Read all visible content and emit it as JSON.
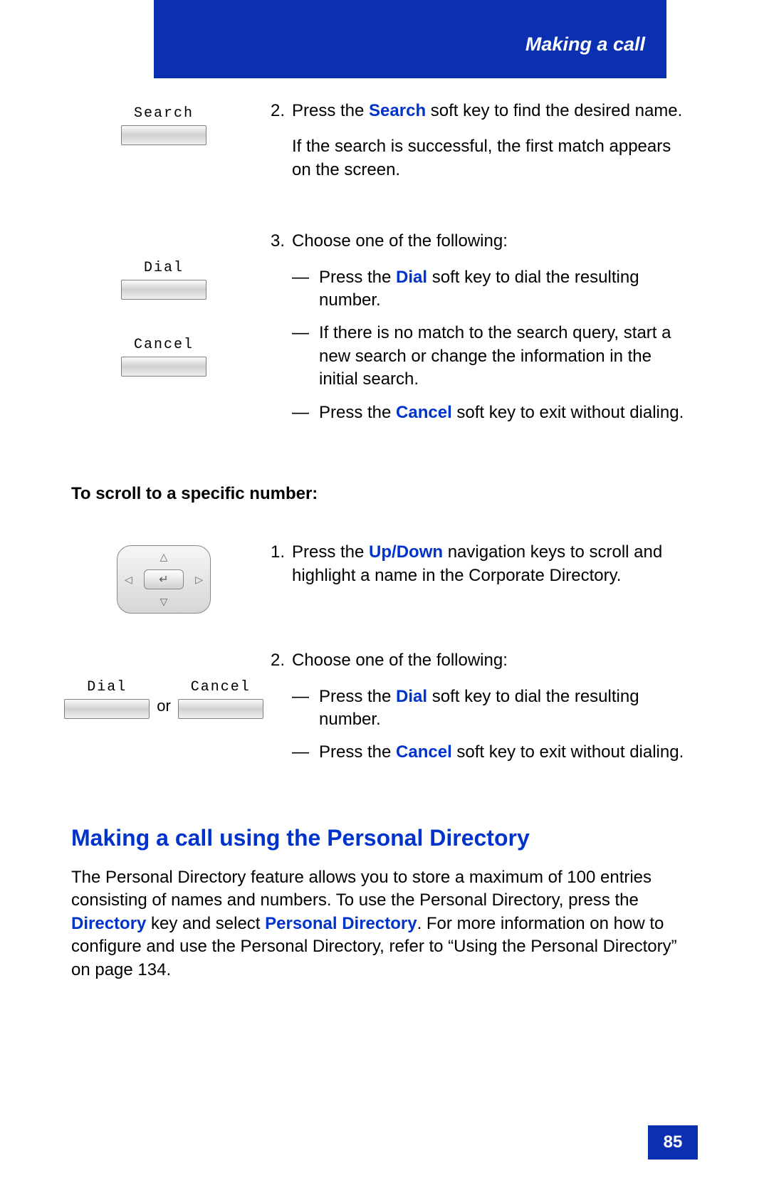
{
  "header": {
    "title": "Making a call"
  },
  "softkeys": {
    "search": "Search",
    "dial": "Dial",
    "cancel": "Cancel",
    "or": "or"
  },
  "step2": {
    "num": "2.",
    "line1_a": "Press the ",
    "line1_kw": "Search",
    "line1_b": " soft key to find the desired name.",
    "line2": "If the search is successful, the first match appears on the screen."
  },
  "step3": {
    "num": "3.",
    "intro": "Choose one of the following:",
    "d1_a": "Press the ",
    "d1_kw": "Dial",
    "d1_b": " soft key to dial the resulting number.",
    "d2": "If there is no match to the search query, start a new search or change the information in the initial search.",
    "d3_a": "Press the ",
    "d3_kw": "Cancel",
    "d3_b": " soft key to exit without dialing."
  },
  "subhead": "To scroll to a specific number:",
  "scroll1": {
    "num": "1.",
    "a": "Press the ",
    "kw": "Up/Down",
    "b": " navigation keys to scroll and highlight a name in the Corporate Directory."
  },
  "scroll2": {
    "num": "2.",
    "intro": "Choose one of the following:",
    "d1_a": "Press the ",
    "d1_kw": "Dial",
    "d1_b": " soft key to dial the resulting number.",
    "d2_a": "Press the ",
    "d2_kw": "Cancel",
    "d2_b": " soft key to exit without dialing."
  },
  "section": {
    "title": "Making a call using the Personal Directory",
    "p_a": "The Personal Directory feature allows you to store a maximum of 100 entries consisting of names and numbers. To use the Personal Directory, press the ",
    "p_kw1": "Directory",
    "p_b": " key and select ",
    "p_kw2": "Personal Directory",
    "p_c": ". For more information on how to configure and use the Personal Directory, refer to “Using the Personal Directory” on page 134."
  },
  "page_number": "85"
}
